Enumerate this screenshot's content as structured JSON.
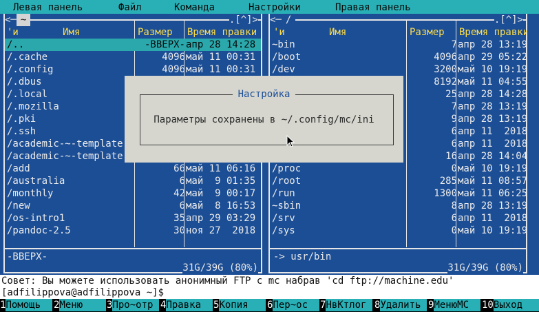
{
  "menubar": {
    "items": [
      "Левая панель",
      "Файл",
      "Команда",
      "Настройки",
      "Правая панель"
    ]
  },
  "left_panel": {
    "path_marker": "<─",
    "path": "~",
    "controls": ".[^]>",
    "headers": {
      "n": "'и",
      "name": "Имя",
      "size": "Размер",
      "mtime": "Время правки"
    },
    "rows": [
      {
        "name": "/..",
        "size": "-ВВЕРХ-",
        "mtime": "апр 28 14:28",
        "selected": true
      },
      {
        "name": "/.cache",
        "size": "4096",
        "mtime": "май 11 00:31"
      },
      {
        "name": "/.config",
        "size": "4096",
        "mtime": "май 11 00:31"
      },
      {
        "name": "/.dbus",
        "size": "",
        "mtime": ""
      },
      {
        "name": "/.local",
        "size": "",
        "mtime": ""
      },
      {
        "name": "/.mozilla",
        "size": "",
        "mtime": ""
      },
      {
        "name": "/.pki",
        "size": "",
        "mtime": ""
      },
      {
        "name": "/.ssh",
        "size": "",
        "mtime": ""
      },
      {
        "name": "/academic-~-template",
        "size": "",
        "mtime": ""
      },
      {
        "name": "/academic-~-template",
        "size": "",
        "mtime": ""
      },
      {
        "name": "/add",
        "size": "66",
        "mtime": "май 11 06:16"
      },
      {
        "name": "/australia",
        "size": "6",
        "mtime": "май  9 01:35"
      },
      {
        "name": "/monthly",
        "size": "42",
        "mtime": "май  9 00:17"
      },
      {
        "name": "/new",
        "size": "6",
        "mtime": "май  8 16:53"
      },
      {
        "name": "/os-intro1",
        "size": "35",
        "mtime": "апр 29 03:29"
      },
      {
        "name": "/pandoc-2.5",
        "size": "30",
        "mtime": "ноя 27  2018"
      }
    ],
    "status": "-ВВЕРХ-",
    "disk": "31G/39G (80%)"
  },
  "right_panel": {
    "path_marker": "<─",
    "path": "/",
    "controls": ".[^]>",
    "headers": {
      "n": "'и",
      "name": "Имя",
      "size": "Размер",
      "mtime": "Время правки"
    },
    "rows": [
      {
        "name": "~bin",
        "size": "7",
        "mtime": "апр 28 13:19"
      },
      {
        "name": "/boot",
        "size": "4096",
        "mtime": "апр 29 05:22"
      },
      {
        "name": "/dev",
        "size": "3200",
        "mtime": "май 10 19:19"
      },
      {
        "name": "",
        "size": "8192",
        "mtime": "май 11 04:55"
      },
      {
        "name": "",
        "size": "25",
        "mtime": "апр 28 14:28"
      },
      {
        "name": "",
        "size": "7",
        "mtime": "апр 28 13:19"
      },
      {
        "name": "",
        "size": "9",
        "mtime": "апр 28 13:19"
      },
      {
        "name": "",
        "size": "6",
        "mtime": "апр 11  2018"
      },
      {
        "name": "",
        "size": "6",
        "mtime": "апр 11  2018"
      },
      {
        "name": "",
        "size": "16",
        "mtime": "апр 28 14:04"
      },
      {
        "name": "/proc",
        "size": "0",
        "mtime": "май 10 19:19"
      },
      {
        "name": "/root",
        "size": "285",
        "mtime": "май 11 08:57"
      },
      {
        "name": "/run",
        "size": "1300",
        "mtime": "май 11 06:25"
      },
      {
        "name": "~sbin",
        "size": "8",
        "mtime": "апр 28 13:19"
      },
      {
        "name": "/srv",
        "size": "6",
        "mtime": "апр 11  2018"
      },
      {
        "name": "/sys",
        "size": "0",
        "mtime": "май 10 19:19"
      }
    ],
    "status": "-> usr/bin",
    "disk": "31G/39G (80%)"
  },
  "dialog": {
    "title": "Настройка",
    "message": "Параметры сохранены в ~/.config/mc/ini"
  },
  "hint": "Совет: Вы можете использовать анонимный FTP с mc набрав 'cd ftp://machine.edu'",
  "prompt": "[adfilippova@adfilippova ~]$",
  "fkeys": [
    {
      "num": "1",
      "label": "Помощь"
    },
    {
      "num": "2",
      "label": "Меню"
    },
    {
      "num": "3",
      "label": "Про~отр"
    },
    {
      "num": "4",
      "label": "Правка"
    },
    {
      "num": "5",
      "label": "Копия"
    },
    {
      "num": "6",
      "label": "Пер~ос"
    },
    {
      "num": "7",
      "label": "НвКтлог"
    },
    {
      "num": "8",
      "label": "Удалить"
    },
    {
      "num": "9",
      "label": "МенюМС"
    },
    {
      "num": "10",
      "label": "Выход"
    }
  ],
  "colors": {
    "panel_bg": "#1c4e95",
    "accent": "#29b0b6",
    "header": "#ffde4a"
  }
}
